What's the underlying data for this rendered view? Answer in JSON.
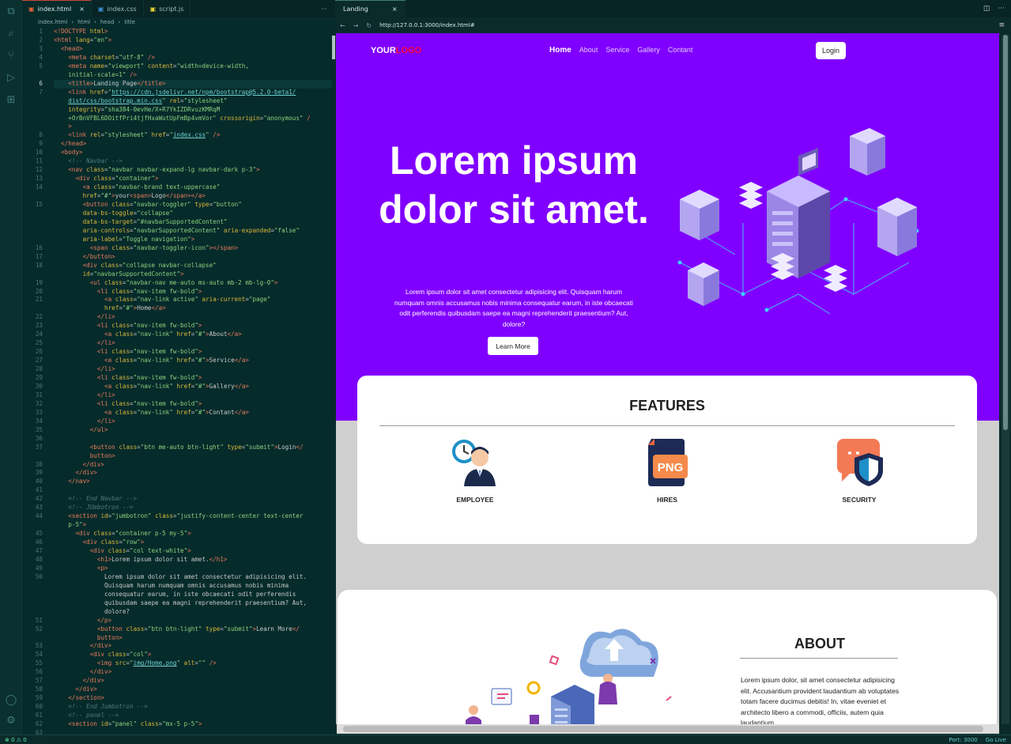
{
  "editor": {
    "tabs": [
      {
        "label": "index.html",
        "icon": "html5-icon",
        "active": true
      },
      {
        "label": "index.css",
        "icon": "css3-icon",
        "active": false
      },
      {
        "label": "script.js",
        "icon": "js-icon",
        "active": false
      }
    ],
    "more": "···",
    "breadcrumb": [
      "index.html",
      "html",
      "head",
      "title"
    ],
    "active_line": 6,
    "lines": [
      {
        "n": "1",
        "html": "<span class='t'>&lt;!DOCTYPE</span> <span class='a'>html</span><span class='t'>&gt;</span>"
      },
      {
        "n": "2",
        "html": "<span class='t'>&lt;html</span> <span class='a'>lang</span>=<span class='s'>\"en\"</span><span class='t'>&gt;</span>"
      },
      {
        "n": "3",
        "html": "  <span class='t'>&lt;head&gt;</span>"
      },
      {
        "n": "4",
        "html": "    <span class='t'>&lt;meta</span> <span class='a'>charset</span>=<span class='s'>\"utf-8\"</span> <span class='t'>/&gt;</span>"
      },
      {
        "n": "5",
        "html": "    <span class='t'>&lt;meta</span> <span class='a'>name</span>=<span class='s'>\"viewport\"</span> <span class='a'>content</span>=<span class='s'>\"width=device-width,</span>"
      },
      {
        "n": "",
        "html": "    <span class='s'>initial-scale=1\"</span> <span class='t'>/&gt;</span>"
      },
      {
        "n": "6",
        "html": "    <span class='t'>&lt;title&gt;</span>Landing Page<span class='t'>&lt;/title&gt;</span>"
      },
      {
        "n": "7",
        "html": "    <span class='t'>&lt;link</span> <span class='a'>href</span>=<span class='s'>\"<span class='u'>https://cdn.jsdelivr.net/npm/bootstrap@5.2.0-beta1/</span></span>"
      },
      {
        "n": "",
        "html": "    <span class='s'><span class='u'>dist/css/bootstrap.min.css</span>\"</span> <span class='a'>rel</span>=<span class='s'>\"stylesheet\"</span>"
      },
      {
        "n": "",
        "html": "    <span class='a'>integrity</span>=<span class='s'>\"sha384-0evHe/X+R7YkIZDRvuzKMRqM</span>"
      },
      {
        "n": "",
        "html": "    <span class='s'>+OrBnVFBL6DOitfPri4tjfHxaWutUpFmBp4vmVor\"</span> <span class='a'>crossorigin</span>=<span class='s'>\"anonymous\"</span> <span class='t'>/</span>"
      },
      {
        "n": "",
        "html": "    <span class='t'>&gt;</span>"
      },
      {
        "n": "8",
        "html": "    <span class='t'>&lt;link</span> <span class='a'>rel</span>=<span class='s'>\"stylesheet\"</span> <span class='a'>href</span>=<span class='s'>\"<span class='u'>index.css</span>\"</span> <span class='t'>/&gt;</span>"
      },
      {
        "n": "9",
        "html": "  <span class='t'>&lt;/head&gt;</span>"
      },
      {
        "n": "10",
        "html": "  <span class='t'>&lt;body&gt;</span>"
      },
      {
        "n": "11",
        "html": "    <span class='c'>&lt;!-- Navbar --&gt;</span>"
      },
      {
        "n": "12",
        "html": "    <span class='t'>&lt;nav</span> <span class='a'>class</span>=<span class='s'>\"navbar navbar-expand-lg navbar-dark p-3\"</span><span class='t'>&gt;</span>"
      },
      {
        "n": "13",
        "html": "      <span class='t'>&lt;div</span> <span class='a'>class</span>=<span class='s'>\"container\"</span><span class='t'>&gt;</span>"
      },
      {
        "n": "14",
        "html": "        <span class='t'>&lt;a</span> <span class='a'>class</span>=<span class='s'>\"navbar-brand text-uppercase\"</span>"
      },
      {
        "n": "",
        "html": "        <span class='a'>href</span>=<span class='s'>\"#\"</span><span class='t'>&gt;</span>your<span class='t'>&lt;span&gt;</span>Logo<span class='t'>&lt;/span&gt;&lt;/a&gt;</span>"
      },
      {
        "n": "15",
        "html": "        <span class='t'>&lt;button</span> <span class='a'>class</span>=<span class='s'>\"navbar-toggler\"</span> <span class='a'>type</span>=<span class='s'>\"button\"</span>"
      },
      {
        "n": "",
        "html": "        <span class='a'>data-bs-toggle</span>=<span class='s'>\"collapse\"</span>"
      },
      {
        "n": "",
        "html": "        <span class='a'>data-bs-target</span>=<span class='s'>\"#navbarSupportedContent\"</span>"
      },
      {
        "n": "",
        "html": "        <span class='a'>aria-controls</span>=<span class='s'>\"navbarSupportedContent\"</span> <span class='a'>aria-expanded</span>=<span class='s'>\"false\"</span>"
      },
      {
        "n": "",
        "html": "        <span class='a'>aria-label</span>=<span class='s'>\"Toggle navigation\"</span><span class='t'>&gt;</span>"
      },
      {
        "n": "16",
        "html": "          <span class='t'>&lt;span</span> <span class='a'>class</span>=<span class='s'>\"navbar-toggler-icon\"</span><span class='t'>&gt;&lt;/span&gt;</span>"
      },
      {
        "n": "17",
        "html": "        <span class='t'>&lt;/button&gt;</span>"
      },
      {
        "n": "18",
        "html": "        <span class='t'>&lt;div</span> <span class='a'>class</span>=<span class='s'>\"collapse navbar-collapse\"</span>"
      },
      {
        "n": "",
        "html": "        <span class='a'>id</span>=<span class='s'>\"navbarSupportedContent\"</span><span class='t'>&gt;</span>"
      },
      {
        "n": "19",
        "html": "          <span class='t'>&lt;ul</span> <span class='a'>class</span>=<span class='s'>\"navbar-nav me-auto ms-auto mb-2 mb-lg-0\"</span><span class='t'>&gt;</span>"
      },
      {
        "n": "20",
        "html": "            <span class='t'>&lt;li</span> <span class='a'>class</span>=<span class='s'>\"nav-item fw-bold\"</span><span class='t'>&gt;</span>"
      },
      {
        "n": "21",
        "html": "              <span class='t'>&lt;a</span> <span class='a'>class</span>=<span class='s'>\"nav-link active\"</span> <span class='a'>aria-current</span>=<span class='s'>\"page\"</span>"
      },
      {
        "n": "",
        "html": "              <span class='a'>href</span>=<span class='s'>\"#\"</span><span class='t'>&gt;</span>Home<span class='t'>&lt;/a&gt;</span>"
      },
      {
        "n": "22",
        "html": "            <span class='t'>&lt;/li&gt;</span>"
      },
      {
        "n": "23",
        "html": "            <span class='t'>&lt;li</span> <span class='a'>class</span>=<span class='s'>\"nav-item fw-bold\"</span><span class='t'>&gt;</span>"
      },
      {
        "n": "24",
        "html": "              <span class='t'>&lt;a</span> <span class='a'>class</span>=<span class='s'>\"nav-link\"</span> <span class='a'>href</span>=<span class='s'>\"#\"</span><span class='t'>&gt;</span>About<span class='t'>&lt;/a&gt;</span>"
      },
      {
        "n": "25",
        "html": "            <span class='t'>&lt;/li&gt;</span>"
      },
      {
        "n": "26",
        "html": "            <span class='t'>&lt;li</span> <span class='a'>class</span>=<span class='s'>\"nav-item fw-bold\"</span><span class='t'>&gt;</span>"
      },
      {
        "n": "27",
        "html": "              <span class='t'>&lt;a</span> <span class='a'>class</span>=<span class='s'>\"nav-link\"</span> <span class='a'>href</span>=<span class='s'>\"#\"</span><span class='t'>&gt;</span>Service<span class='t'>&lt;/a&gt;</span>"
      },
      {
        "n": "28",
        "html": "            <span class='t'>&lt;/li&gt;</span>"
      },
      {
        "n": "29",
        "html": "            <span class='t'>&lt;li</span> <span class='a'>class</span>=<span class='s'>\"nav-item fw-bold\"</span><span class='t'>&gt;</span>"
      },
      {
        "n": "30",
        "html": "              <span class='t'>&lt;a</span> <span class='a'>class</span>=<span class='s'>\"nav-link\"</span> <span class='a'>href</span>=<span class='s'>\"#\"</span><span class='t'>&gt;</span>Gallery<span class='t'>&lt;/a&gt;</span>"
      },
      {
        "n": "31",
        "html": "            <span class='t'>&lt;/li&gt;</span>"
      },
      {
        "n": "32",
        "html": "            <span class='t'>&lt;li</span> <span class='a'>class</span>=<span class='s'>\"nav-item fw-bold\"</span><span class='t'>&gt;</span>"
      },
      {
        "n": "33",
        "html": "              <span class='t'>&lt;a</span> <span class='a'>class</span>=<span class='s'>\"nav-link\"</span> <span class='a'>href</span>=<span class='s'>\"#\"</span><span class='t'>&gt;</span>Contant<span class='t'>&lt;/a&gt;</span>"
      },
      {
        "n": "34",
        "html": "            <span class='t'>&lt;/li&gt;</span>"
      },
      {
        "n": "35",
        "html": "          <span class='t'>&lt;/ul&gt;</span>"
      },
      {
        "n": "36",
        "html": ""
      },
      {
        "n": "37",
        "html": "          <span class='t'>&lt;button</span> <span class='a'>class</span>=<span class='s'>\"btn me-auto btn-light\"</span> <span class='a'>type</span>=<span class='s'>\"submit\"</span><span class='t'>&gt;</span>Login<span class='t'>&lt;/</span>"
      },
      {
        "n": "",
        "html": "          <span class='t'>button&gt;</span>"
      },
      {
        "n": "38",
        "html": "        <span class='t'>&lt;/div&gt;</span>"
      },
      {
        "n": "39",
        "html": "      <span class='t'>&lt;/div&gt;</span>"
      },
      {
        "n": "40",
        "html": "    <span class='t'>&lt;/nav&gt;</span>"
      },
      {
        "n": "41",
        "html": ""
      },
      {
        "n": "42",
        "html": "    <span class='c'>&lt;!-- End Navbar --&gt;</span>"
      },
      {
        "n": "43",
        "html": "    <span class='c'>&lt;!-- JUmbotron --&gt;</span>"
      },
      {
        "n": "44",
        "html": "    <span class='t'>&lt;section</span> <span class='a'>id</span>=<span class='s'>\"jumbotron\"</span> <span class='a'>class</span>=<span class='s'>\"justify-content-center text-center</span>"
      },
      {
        "n": "",
        "html": "    <span class='s'>p-5\"</span><span class='t'>&gt;</span>"
      },
      {
        "n": "45",
        "html": "      <span class='t'>&lt;div</span> <span class='a'>class</span>=<span class='s'>\"container p-5 my-5\"</span><span class='t'>&gt;</span>"
      },
      {
        "n": "46",
        "html": "        <span class='t'>&lt;div</span> <span class='a'>class</span>=<span class='s'>\"row\"</span><span class='t'>&gt;</span>"
      },
      {
        "n": "47",
        "html": "          <span class='t'>&lt;div</span> <span class='a'>class</span>=<span class='s'>\"col text-white\"</span><span class='t'>&gt;</span>"
      },
      {
        "n": "48",
        "html": "            <span class='t'>&lt;h1&gt;</span>Lorem ipsum dolor sit amet.<span class='t'>&lt;/h1&gt;</span>"
      },
      {
        "n": "49",
        "html": "            <span class='t'>&lt;p&gt;</span>"
      },
      {
        "n": "50",
        "html": "              Lorem ipsum dolor sit amet consectetur adipisicing elit."
      },
      {
        "n": "",
        "html": "              Quisquam harum numquam omnis accusamus nobis minima"
      },
      {
        "n": "",
        "html": "              consequatur earum, in iste obcaecati odit perferendis"
      },
      {
        "n": "",
        "html": "              quibusdam saepe ea magni reprehenderit praesentium? Aut,"
      },
      {
        "n": "",
        "html": "              dolore?"
      },
      {
        "n": "51",
        "html": "            <span class='t'>&lt;/p&gt;</span>"
      },
      {
        "n": "52",
        "html": "            <span class='t'>&lt;button</span> <span class='a'>class</span>=<span class='s'>\"btn btn-light\"</span> <span class='a'>type</span>=<span class='s'>\"submit\"</span><span class='t'>&gt;</span>Learn More<span class='t'>&lt;/</span>"
      },
      {
        "n": "",
        "html": "            <span class='t'>button&gt;</span>"
      },
      {
        "n": "53",
        "html": "          <span class='t'>&lt;/div&gt;</span>"
      },
      {
        "n": "54",
        "html": "          <span class='t'>&lt;div</span> <span class='a'>class</span>=<span class='s'>\"col\"</span><span class='t'>&gt;</span>"
      },
      {
        "n": "55",
        "html": "            <span class='t'>&lt;img</span> <span class='a'>src</span>=<span class='s'>\"<span class='u'>img/Home.png</span>\"</span> <span class='a'>alt</span>=<span class='s'>\"\"</span> <span class='t'>/&gt;</span>"
      },
      {
        "n": "56",
        "html": "          <span class='t'>&lt;/div&gt;</span>"
      },
      {
        "n": "57",
        "html": "        <span class='t'>&lt;/div&gt;</span>"
      },
      {
        "n": "58",
        "html": "      <span class='t'>&lt;/div&gt;</span>"
      },
      {
        "n": "59",
        "html": "    <span class='t'>&lt;/section&gt;</span>"
      },
      {
        "n": "60",
        "html": "    <span class='c'>&lt;!-- End Jumbotron --&gt;</span>"
      },
      {
        "n": "61",
        "html": "    <span class='c'>&lt;!-- panel --&gt;</span>"
      },
      {
        "n": "62",
        "html": "    <span class='t'>&lt;section</span> <span class='a'>id</span>=<span class='s'>\"panel\"</span> <span class='a'>class</span>=<span class='s'>\"mx-5 p-5\"</span><span class='t'>&gt;</span>"
      },
      {
        "n": "63",
        "html": ""
      }
    ]
  },
  "browser": {
    "tab_title": "Landing",
    "close": "×",
    "url": "http://127.0.0.1:3000/index.html#"
  },
  "site": {
    "logo_main": "YOUR",
    "logo_accent": "LOGO",
    "nav": [
      "Home",
      "About",
      "Service",
      "Gallery",
      "Contant"
    ],
    "login": "Login",
    "hero_title": "Lorem ipsum dolor sit amet.",
    "hero_text": "Lorem ipsum dolor sit amet consectetur adipisicing elit. Quisquam harum numquam omnis accusamus nobis minima consequatur earum, in iste obcaecati odit perferendis quibusdam saepe ea magni reprehenderit praesentium? Aut, dolore?",
    "learn_more": "Learn More",
    "features_title": "FEATURES",
    "features": [
      {
        "label": "EMPLOYEE",
        "icon": "employee-icon"
      },
      {
        "label": "HIRES",
        "icon": "png-file-icon"
      },
      {
        "label": "SECURITY",
        "icon": "security-shield-icon"
      }
    ],
    "about_title": "ABOUT",
    "about_text": "Lorem ipsum dolor, sit amet consectetur adipisicing elit. Accusantium provident laudantium ab voluptates totam facere ducimus debitis! In, vitae eveniet et architecto libero a commodi, officiis, autem quia laudantium"
  },
  "status": {
    "left": "⊗ 0 ⚠ 0",
    "port": "Port: 3000",
    "live": "Go Live"
  },
  "colors": {
    "hero_bg": "#8000ff",
    "logo_accent": "#ff0033",
    "editor_bg": "#062b2b"
  }
}
